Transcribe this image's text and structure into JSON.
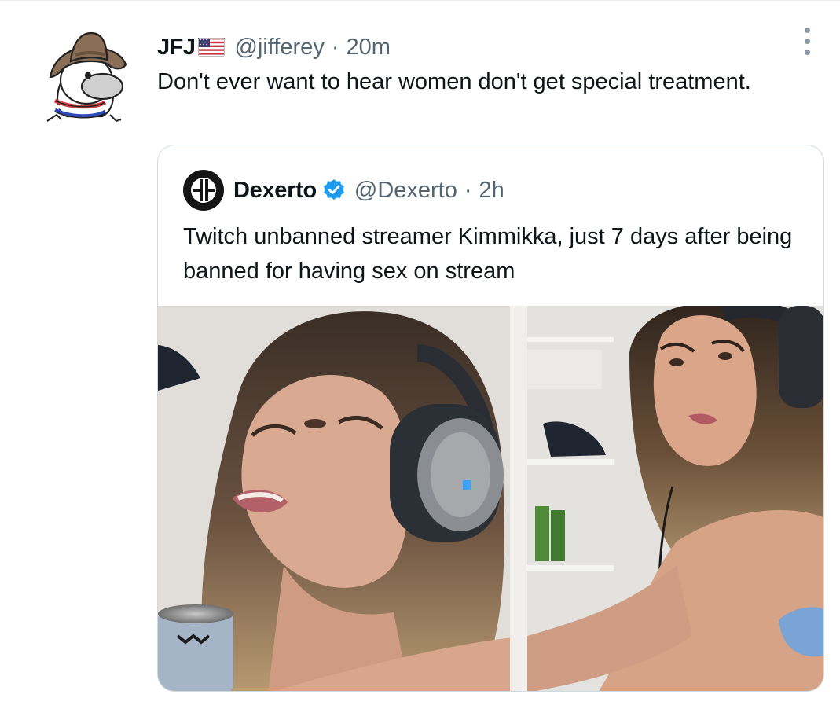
{
  "tweet": {
    "author_name": "JFJ",
    "author_flag_icon": "us-flag-icon",
    "author_handle": "@jifferey",
    "separator": "·",
    "timestamp": "20m",
    "text": "Don't ever want to hear women don't get special treatment.",
    "more_icon": "more-options-icon"
  },
  "quote": {
    "author_name": "Dexerto",
    "verified_icon": "verified-badge-icon",
    "author_handle": "@Dexerto",
    "separator": "·",
    "timestamp": "2h",
    "text": "Twitch unbanned streamer Kimmikka, just 7 days after being banned for having sex on stream"
  },
  "colors": {
    "text": "#0f1419",
    "secondary": "#536471",
    "verified": "#1d9bf0",
    "border": "#cfd9de"
  }
}
